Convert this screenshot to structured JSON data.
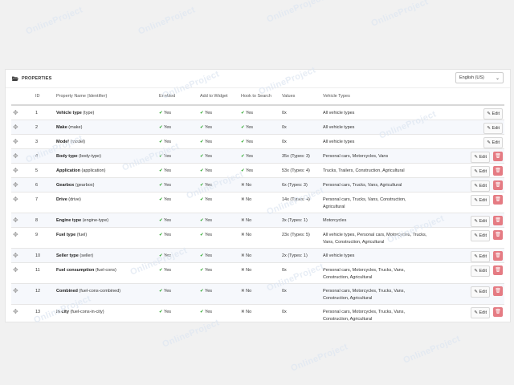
{
  "watermark": "OnlineProject",
  "panel": {
    "title": "PROPERTIES",
    "icon": "folder-open-icon",
    "language": "English (US)"
  },
  "columns": [
    "ID",
    "Property Name (Identifier)",
    "Enabled",
    "Add to Widget",
    "Hook to Search",
    "Values",
    "Vehicle Types"
  ],
  "actions": {
    "edit": "Edit"
  },
  "rows": [
    {
      "id": "1",
      "name": "Vehicle type",
      "ident": "(type)",
      "enabled": "Yes",
      "widget": "Yes",
      "search": "Yes",
      "search_on": true,
      "values": "0x",
      "types": "All vehicle types",
      "del": false,
      "h": 1
    },
    {
      "id": "2",
      "name": "Make",
      "ident": "(make)",
      "enabled": "Yes",
      "widget": "Yes",
      "search": "Yes",
      "search_on": true,
      "values": "0x",
      "types": "All vehicle types",
      "del": false,
      "h": 1
    },
    {
      "id": "3",
      "name": "Model",
      "ident": "(model)",
      "enabled": "Yes",
      "widget": "Yes",
      "search": "Yes",
      "search_on": true,
      "values": "0x",
      "types": "All vehicle types",
      "del": false,
      "h": 1
    },
    {
      "id": "4",
      "name": "Body type",
      "ident": "(body-type)",
      "enabled": "Yes",
      "widget": "Yes",
      "search": "Yes",
      "search_on": true,
      "values": "35x (Types: 3)",
      "types": "Personal cars, Motorcycles, Vans",
      "del": true,
      "h": 1
    },
    {
      "id": "5",
      "name": "Application",
      "ident": "(application)",
      "enabled": "Yes",
      "widget": "Yes",
      "search": "Yes",
      "search_on": true,
      "values": "53x (Types: 4)",
      "types": "Trucks, Trailers, Construction, Agricultural",
      "del": true,
      "h": 1
    },
    {
      "id": "6",
      "name": "Gearbox",
      "ident": "(gearbox)",
      "enabled": "Yes",
      "widget": "Yes",
      "search": "No",
      "search_on": false,
      "values": "6x (Types: 3)",
      "types": "Personal cars, Trucks, Vans, Agricultural",
      "del": true,
      "h": 1
    },
    {
      "id": "7",
      "name": "Drive",
      "ident": "(drive)",
      "enabled": "Yes",
      "widget": "Yes",
      "search": "No",
      "search_on": false,
      "values": "14x (Types: 4)",
      "types": "Personal cars, Trucks, Vans, Construction, Agricultural",
      "del": true,
      "h": 2
    },
    {
      "id": "8",
      "name": "Engine type",
      "ident": "(engine-type)",
      "enabled": "Yes",
      "widget": "Yes",
      "search": "No",
      "search_on": false,
      "values": "3x (Types: 1)",
      "types": "Motorcycles",
      "del": true,
      "h": 1
    },
    {
      "id": "9",
      "name": "Fuel type",
      "ident": "(fuel)",
      "enabled": "Yes",
      "widget": "Yes",
      "search": "No",
      "search_on": false,
      "values": "23x (Types: 5)",
      "types": "All vehicle types, Personal cars, Motorcycles, Trucks, Vans, Construction, Agricultural",
      "del": true,
      "h": 2
    },
    {
      "id": "10",
      "name": "Seller type",
      "ident": "(seller)",
      "enabled": "Yes",
      "widget": "Yes",
      "search": "No",
      "search_on": false,
      "values": "2x (Types: 1)",
      "types": "All vehicle types",
      "del": true,
      "h": 1
    },
    {
      "id": "11",
      "name": "Fuel consumption",
      "ident": "(fuel-cons)",
      "enabled": "Yes",
      "widget": "Yes",
      "search": "No",
      "search_on": false,
      "values": "0x",
      "types": "Personal cars, Motorcycles, Trucks, Vans, Construction, Agricultural",
      "del": true,
      "h": 2
    },
    {
      "id": "12",
      "name": "Combined",
      "ident": "(fuel-cons-combined)",
      "enabled": "Yes",
      "widget": "Yes",
      "search": "No",
      "search_on": false,
      "values": "0x",
      "types": "Personal cars, Motorcycles, Trucks, Vans, Construction, Agricultural",
      "del": true,
      "h": 2
    },
    {
      "id": "13",
      "name": "In city",
      "ident": "(fuel-cons-in-city)",
      "enabled": "Yes",
      "widget": "Yes",
      "search": "No",
      "search_on": false,
      "values": "0x",
      "types": "Personal cars, Motorcycles, Trucks, Vans, Construction, Agricultural",
      "del": true,
      "h": 2
    }
  ]
}
